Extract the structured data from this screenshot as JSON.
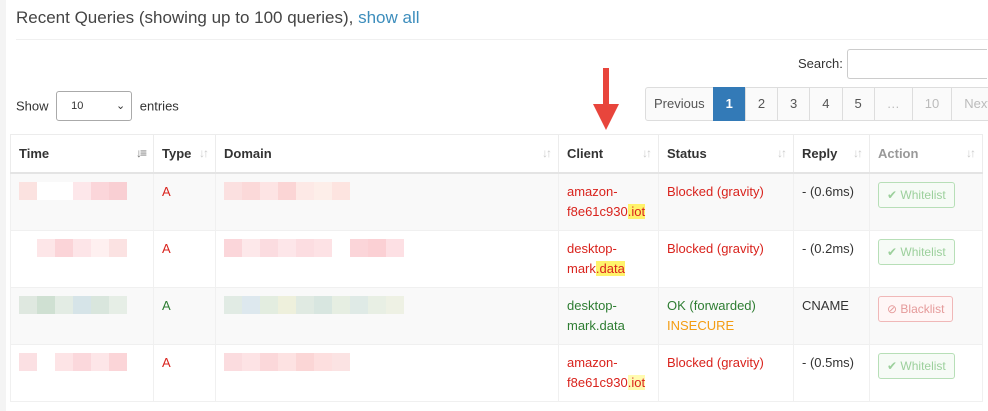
{
  "header": {
    "title": "Recent Queries (showing up to 100 queries), ",
    "link": "show all"
  },
  "length": {
    "prefix": "Show",
    "value": "10",
    "suffix": "entries",
    "chevron_icon": "chevron-down-icon"
  },
  "search": {
    "label": "Search:",
    "value": ""
  },
  "pagination": {
    "previous": "Previous",
    "pages": [
      "1",
      "2",
      "3",
      "4",
      "5"
    ],
    "ellipsis": "…",
    "last": "10",
    "next": "Next"
  },
  "table": {
    "columns": [
      "Time",
      "Type",
      "Domain",
      "Client",
      "Status",
      "Reply",
      "Action"
    ],
    "rows": [
      {
        "type": "A",
        "client_line1": "amazon-",
        "client_line2_pre": "f8e61c930",
        "client_line2_hl": ".iot",
        "status_line1": "Blocked (gravity)",
        "status_line2": "",
        "reply": "- (0.6ms)",
        "action": "Whitelist"
      },
      {
        "type": "A",
        "client_line1": "desktop-",
        "client_line2_pre": "mark",
        "client_line2_hl": ".data",
        "status_line1": "Blocked (gravity)",
        "status_line2": "",
        "reply": "- (0.2ms)",
        "action": "Whitelist"
      },
      {
        "type": "A",
        "client_line1": "desktop-",
        "client_line2_pre": "mark.data",
        "client_line2_hl": "",
        "status_line1": "OK (forwarded)",
        "status_line2": "INSECURE",
        "reply": "CNAME",
        "action": "Blacklist"
      },
      {
        "type": "A",
        "client_line1": "amazon-",
        "client_line2_pre": "f8e61c930",
        "client_line2_hl": ".iot",
        "status_line1": "Blocked (gravity)",
        "status_line2": "",
        "reply": "- (0.5ms)",
        "action": "Whitelist"
      }
    ]
  },
  "colors": {
    "link": "#3c8dbc",
    "active_page": "#337ab7",
    "blocked": "#d9231d",
    "ok": "#2e7d32",
    "insecure": "#f39c12",
    "highlight": "#fff36b",
    "arrow": "#e8453c"
  }
}
